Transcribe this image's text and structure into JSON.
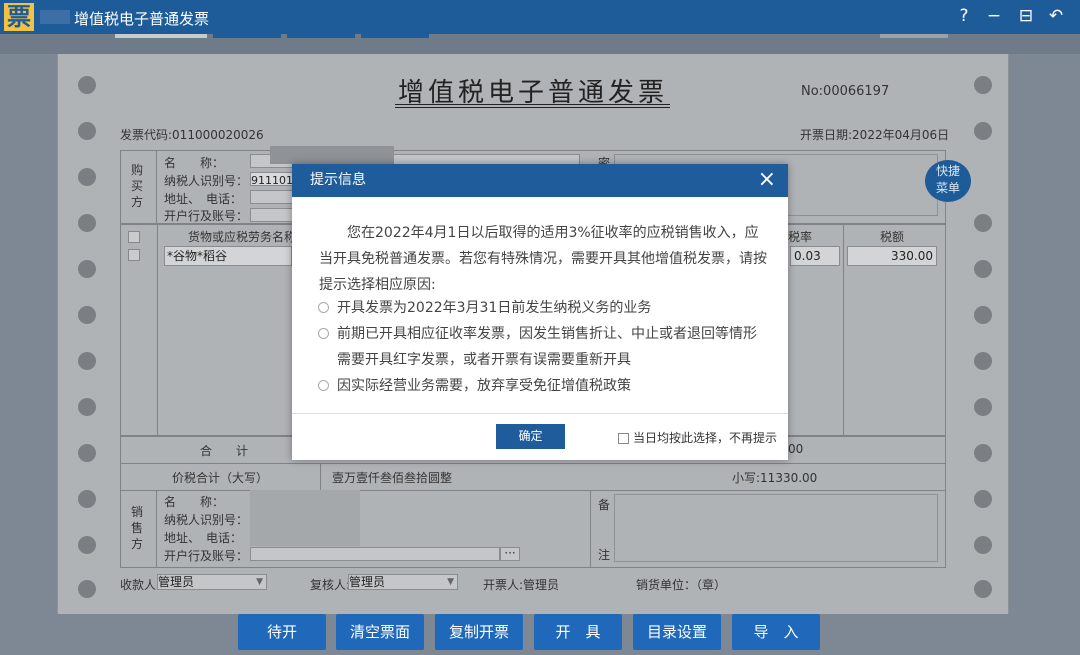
{
  "app": {
    "logo": "票",
    "title": "增值税电子普通发票"
  },
  "window_controls": [
    "?",
    "−",
    "⊟",
    "↶"
  ],
  "invoice": {
    "title": "增值税电子普通发票",
    "no_label": "No:00066197",
    "code_label": "发票代码:011000020026",
    "date_label": "开票日期:2022年04月06日",
    "buyer_section": "购买方",
    "buyer_fields": [
      "名　　称：",
      "纳税人识别号：",
      "地址、　电话：",
      "开户行及账号："
    ],
    "buyer_tax_id_partial": "9111010",
    "items_header": "货物或应税劳务名称",
    "tax_rate_header": "税率",
    "tax_amount_header": "税额",
    "item_name": "*谷物*稻谷",
    "item_tax_rate": "0.03",
    "item_tax_amount": "330.00",
    "total_label": "合　　计",
    "total_amount_tail": "00",
    "price_tax_label": "价税合计（大写）",
    "price_tax_upper": "壹万壹仟叁佰叁拾圆整",
    "price_tax_lower": "小写:11330.00",
    "seller_section": "销售方",
    "seller_fields": [
      "名　　称：",
      "纳税人识别号：",
      "地址、　电话：",
      "开户行及账号："
    ],
    "remark_label_1": "备",
    "remark_label_2": "注",
    "password_label": "密",
    "payee_label": "收款人:",
    "payee_value": "管理员",
    "reviewer_label": "复核人:",
    "reviewer_value": "管理员",
    "drawer_label": "开票人:管理员",
    "seller_unit_label": "销货单位：（章）"
  },
  "quick_menu": "快捷菜单",
  "bottom_buttons": [
    "待开",
    "清空票面",
    "复制开票",
    "开　具",
    "目录设置",
    "导　入"
  ],
  "dialog": {
    "title": "提示信息",
    "close": "×",
    "message": "您在2022年4月1日以后取得的适用3%征收率的应税销售收入，应当开具免税普通发票。若您有特殊情况，需要开具其他增值税发票，请按提示选择相应原因:",
    "options": [
      "开具发票为2022年3月31日前发生纳税义务的业务",
      "前期已开具相应征收率发票，因发生销售折让、中止或者退回等情形需要开具红字发票，或者开票有误需要重新开具",
      "因实际经营业务需要，放弃享受免征增值税政策"
    ],
    "confirm": "确定",
    "dont_remind": "当日均按此选择，不再提示"
  }
}
